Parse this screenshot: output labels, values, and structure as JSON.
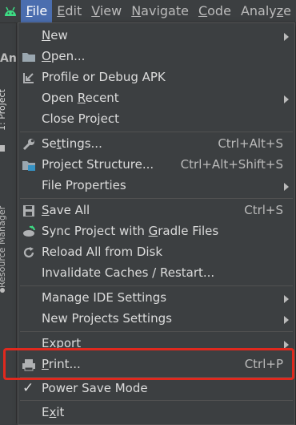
{
  "menubar": {
    "items": [
      {
        "pre": "",
        "mn": "F",
        "post": "ile",
        "active": true
      },
      {
        "pre": "",
        "mn": "E",
        "post": "dit"
      },
      {
        "pre": "",
        "mn": "V",
        "post": "iew"
      },
      {
        "pre": "",
        "mn": "N",
        "post": "avigate"
      },
      {
        "pre": "",
        "mn": "C",
        "post": "ode"
      },
      {
        "pre": "Analy",
        "mn": "z",
        "post": "e"
      }
    ]
  },
  "sidebar": {
    "project_abbrev": "An",
    "tab_project": "1: Project",
    "tab_resource_manager": "Resource Manager"
  },
  "file_menu": {
    "items": [
      {
        "pre": "",
        "mn": "N",
        "post": "ew",
        "icon": "none",
        "submenu": true
      },
      {
        "pre": "",
        "mn": "O",
        "post": "pen...",
        "icon": "folder-icon"
      },
      {
        "pre": "Profile or Debug APK",
        "mn": "",
        "post": "",
        "icon": "profile-apk-icon"
      },
      {
        "pre": "Open ",
        "mn": "R",
        "post": "ecent",
        "icon": "none",
        "submenu": true
      },
      {
        "pre": "Close Project",
        "mn": "",
        "post": "",
        "icon": "none"
      },
      {
        "pre": "Se",
        "mn": "t",
        "post": "tings...",
        "icon": "wrench-icon",
        "shortcut": "Ctrl+Alt+S"
      },
      {
        "pre": "Project Structure...",
        "mn": "",
        "post": "",
        "icon": "project-structure-icon",
        "shortcut": "Ctrl+Alt+Shift+S"
      },
      {
        "pre": "File Properties",
        "mn": "",
        "post": "",
        "icon": "none",
        "submenu": true
      },
      {
        "pre": "",
        "mn": "S",
        "post": "ave All",
        "icon": "save-icon",
        "shortcut": "Ctrl+S"
      },
      {
        "pre": "Sync Project with ",
        "mn": "G",
        "post": "radle Files",
        "icon": "gradle-sync-icon"
      },
      {
        "pre": "Reload All from Disk",
        "mn": "",
        "post": "",
        "icon": "reload-icon"
      },
      {
        "pre": "Invalidate Caches / Restart...",
        "mn": "",
        "post": "",
        "icon": "none"
      },
      {
        "pre": "Manage IDE Settings",
        "mn": "",
        "post": "",
        "icon": "none",
        "submenu": true
      },
      {
        "pre": "New Projects Settings",
        "mn": "",
        "post": "",
        "icon": "none",
        "submenu": true
      },
      {
        "pre": "Export",
        "mn": "",
        "post": "",
        "icon": "none",
        "submenu": true
      },
      {
        "pre": "",
        "mn": "P",
        "post": "rint...",
        "icon": "print-icon",
        "shortcut": "Ctrl+P"
      },
      {
        "pre": "Power Save Mode",
        "mn": "",
        "post": "",
        "icon": "checkmark-icon",
        "checked": true
      },
      {
        "pre": "E",
        "mn": "x",
        "post": "it",
        "icon": "none"
      }
    ]
  }
}
